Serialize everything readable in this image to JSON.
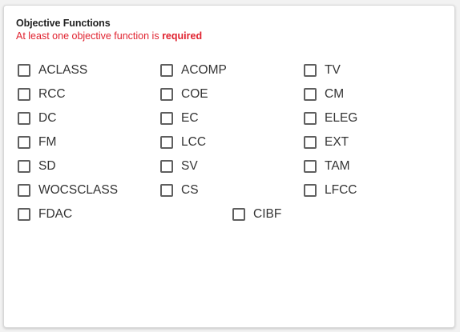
{
  "section": {
    "title": "Objective Functions",
    "subtitle_prefix": "At least one objective function is ",
    "subtitle_emphasis": "required"
  },
  "options": {
    "aclass": {
      "label": "ACLASS",
      "checked": false
    },
    "acomp": {
      "label": "ACOMP",
      "checked": false
    },
    "tv": {
      "label": "TV",
      "checked": false
    },
    "rcc": {
      "label": "RCC",
      "checked": false
    },
    "coe": {
      "label": "COE",
      "checked": false
    },
    "cm": {
      "label": "CM",
      "checked": false
    },
    "dc": {
      "label": "DC",
      "checked": false
    },
    "ec": {
      "label": "EC",
      "checked": false
    },
    "eleg": {
      "label": "ELEG",
      "checked": false
    },
    "fm": {
      "label": "FM",
      "checked": false
    },
    "lcc": {
      "label": "LCC",
      "checked": false
    },
    "ext": {
      "label": "EXT",
      "checked": false
    },
    "sd": {
      "label": "SD",
      "checked": false
    },
    "sv": {
      "label": "SV",
      "checked": false
    },
    "tam": {
      "label": "TAM",
      "checked": false
    },
    "wocsclass": {
      "label": "WOCSCLASS",
      "checked": false
    },
    "cs": {
      "label": "CS",
      "checked": false
    },
    "lfcc": {
      "label": "LFCC",
      "checked": false
    },
    "fdac": {
      "label": "FDAC",
      "checked": false
    },
    "cibf": {
      "label": "CIBF",
      "checked": false
    }
  },
  "colors": {
    "required_text": "#e0222f",
    "checkbox_border": "#5f5f5f"
  }
}
